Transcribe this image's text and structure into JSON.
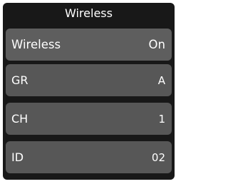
{
  "header": {
    "title": "Wireless"
  },
  "items": [
    {
      "label": "Wireless",
      "value": "On"
    },
    {
      "label": "GR",
      "value": "A"
    },
    {
      "label": "CH",
      "value": "1"
    },
    {
      "label": "ID",
      "value": "02"
    }
  ]
}
